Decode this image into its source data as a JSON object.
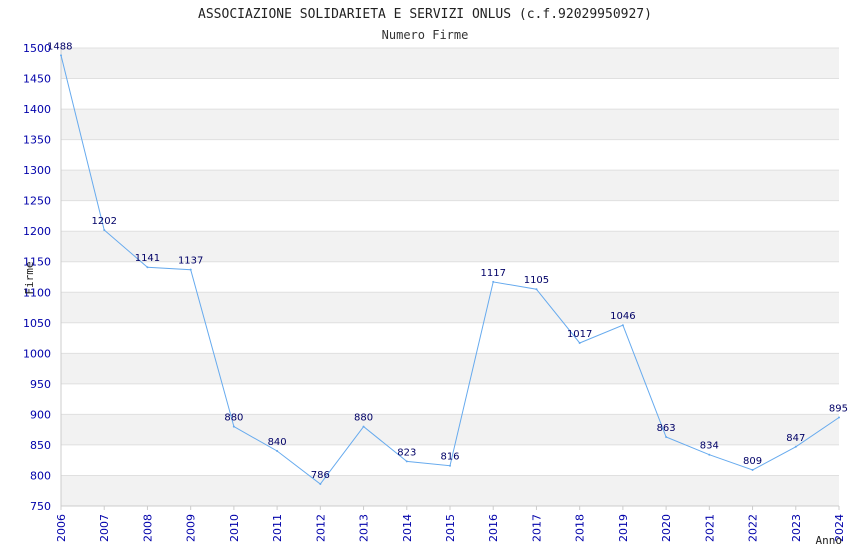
{
  "chart_data": {
    "type": "line",
    "title": "ASSOCIAZIONE SOLIDARIETA E SERVIZI ONLUS (c.f.92029950927)",
    "subtitle": "Numero Firme",
    "xlabel": "Anno",
    "ylabel": "Firme",
    "x": [
      "2006",
      "2007",
      "2008",
      "2009",
      "2010",
      "2011",
      "2012",
      "2013",
      "2014",
      "2015",
      "2016",
      "2017",
      "2018",
      "2019",
      "2020",
      "2021",
      "2022",
      "2023",
      "2024"
    ],
    "series": [
      {
        "values": [
          1488,
          1202,
          1141,
          1137,
          880,
          840,
          786,
          880,
          823,
          816,
          1117,
          1105,
          1017,
          1046,
          863,
          834,
          809,
          847,
          895
        ]
      }
    ],
    "ylim": [
      750,
      1500
    ],
    "yticks": [
      750,
      800,
      850,
      900,
      950,
      1000,
      1050,
      1100,
      1150,
      1200,
      1250,
      1300,
      1350,
      1400,
      1450,
      1500
    ],
    "grid": "horizontal bands",
    "colors": {
      "line": "#66aaee",
      "band": "#f2f2f2",
      "tick_text": "#0000aa",
      "data_label": "#000066"
    }
  }
}
